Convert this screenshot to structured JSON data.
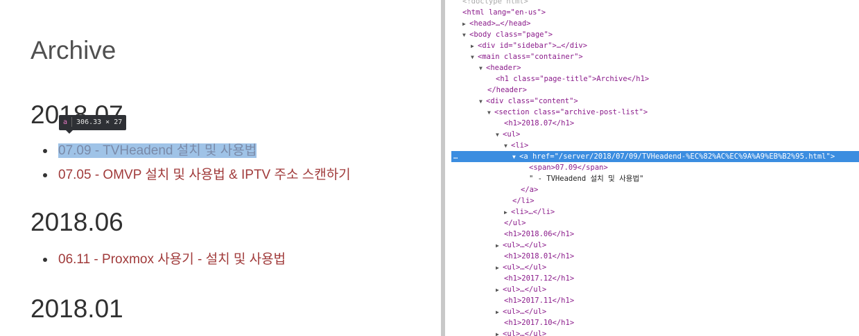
{
  "page": {
    "title": "Archive",
    "sections": [
      {
        "year": "2018.07",
        "posts": [
          {
            "date": "07.09",
            "text": " - TVHeadend 설치 및 사용법"
          },
          {
            "date": "07.05",
            "text": " - OMVP 설치 및 사용법 & IPTV 주소 스캔하기"
          }
        ]
      },
      {
        "year": "2018.06",
        "posts": [
          {
            "date": "06.11",
            "text": " - Proxmox 사용기 - 설치 및 사용법"
          }
        ]
      },
      {
        "year": "2018.01",
        "posts": []
      }
    ]
  },
  "tooltip": {
    "tag": "a",
    "size": "306.33 × 27"
  },
  "devtools": {
    "lines": [
      "<!doctype html>",
      "<html lang=\"en-us\">",
      "<head>…</head>",
      "<body class=\"page\">",
      "<div id=\"sidebar\">…</div>",
      "<main class=\"container\">",
      "<header>",
      "<h1 class=\"page-title\">Archive</h1>",
      "</header>",
      "<div class=\"content\">",
      "<section class=\"archive-post-list\">",
      "<h1>2018.07</h1>",
      "<ul>",
      "<li>",
      "<a href=\"/server/2018/07/09/TVHeadend-%EC%82%AC%EC%9A%A9%EB%B2%95.html\">",
      "<span>07.09</span>",
      "\" - TVHeadend 설치 및 사용법\"",
      "</a>",
      "</li>",
      "<li>…</li>",
      "</ul>",
      "<h1>2018.06</h1>",
      "<ul>…</ul>",
      "<h1>2018.01</h1>",
      "<ul>…</ul>",
      "<h1>2017.12</h1>",
      "<ul>…</ul>",
      "<h1>2017.11</h1>",
      "<ul>…</ul>",
      "<h1>2017.10</h1>",
      "<ul>…</ul>"
    ],
    "selected_prefix": "…",
    "selected_suffix": "="
  }
}
